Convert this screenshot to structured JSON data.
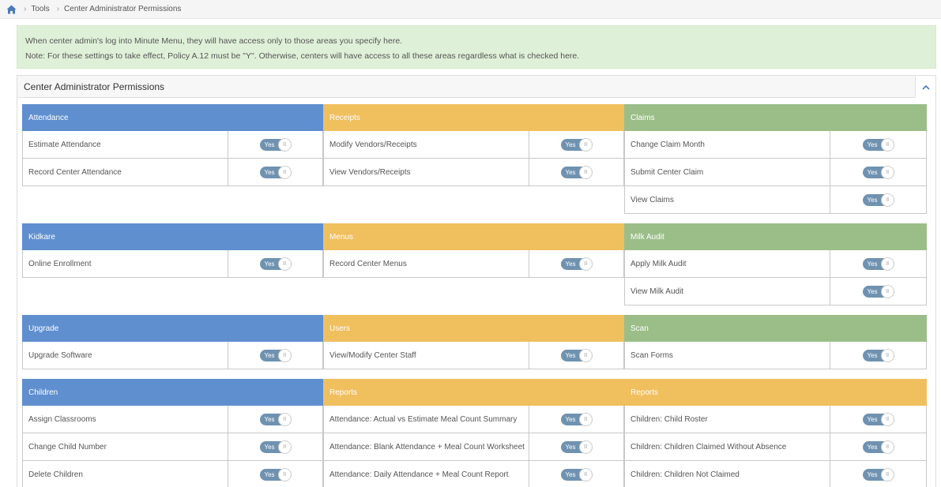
{
  "breadcrumb": {
    "home_icon": "home-icon",
    "items": [
      "Tools",
      "Center Administrator Permissions"
    ]
  },
  "alert": {
    "line1": "When center admin's log into Minute Menu, they will have access only to those areas you specify here.",
    "line2": "Note: For these settings to take effect, Policy A.12 must be \"Y\". Otherwise, centers will have access to all these areas regardless what is checked here."
  },
  "panel": {
    "title": "Center Administrator Permissions",
    "collapse_icon": "chevron-up-icon"
  },
  "toggle_text": "Yes",
  "toggle_knob": "III",
  "colors": {
    "blue": "#5f8fcf",
    "orange": "#f0bf5e",
    "green": "#9bbe88",
    "toggle": "#6f92b0",
    "alert_bg": "#dff0d8"
  },
  "groups": [
    {
      "sections": [
        {
          "title": "Attendance",
          "items": [
            "Estimate Attendance",
            "Record Center Attendance"
          ]
        },
        {
          "title": "Receipts",
          "items": [
            "Modify Vendors/Receipts",
            "View Vendors/Receipts"
          ]
        },
        {
          "title": "Claims",
          "items": [
            "Change Claim Month",
            "Submit Center Claim",
            "View Claims"
          ]
        }
      ]
    },
    {
      "sections": [
        {
          "title": "Kidkare",
          "items": [
            "Online Enrollment"
          ]
        },
        {
          "title": "Menus",
          "items": [
            "Record Center Menus"
          ]
        },
        {
          "title": "Milk Audit",
          "items": [
            "Apply Milk Audit",
            "View Milk Audit"
          ]
        }
      ]
    },
    {
      "sections": [
        {
          "title": "Upgrade",
          "items": [
            "Upgrade Software"
          ]
        },
        {
          "title": "Users",
          "items": [
            "View/Modify Center Staff"
          ]
        },
        {
          "title": "Scan",
          "items": [
            "Scan Forms"
          ]
        }
      ]
    },
    {
      "sections": [
        {
          "title": "Children",
          "items": [
            "Assign Classrooms",
            "Change Child Number",
            "Delete Children"
          ]
        },
        {
          "title": "Reports",
          "items": [
            "Attendance: Actual vs Estimate Meal Count Summary",
            "Attendance: Blank Attendance + Meal Count Worksheet",
            "Attendance: Daily Attendance + Meal Count Report"
          ]
        },
        {
          "title": "Reports",
          "items": [
            "Children: Child Roster",
            "Children: Children Claimed Without Absence",
            "Children: Children Not Claimed"
          ]
        }
      ]
    }
  ]
}
